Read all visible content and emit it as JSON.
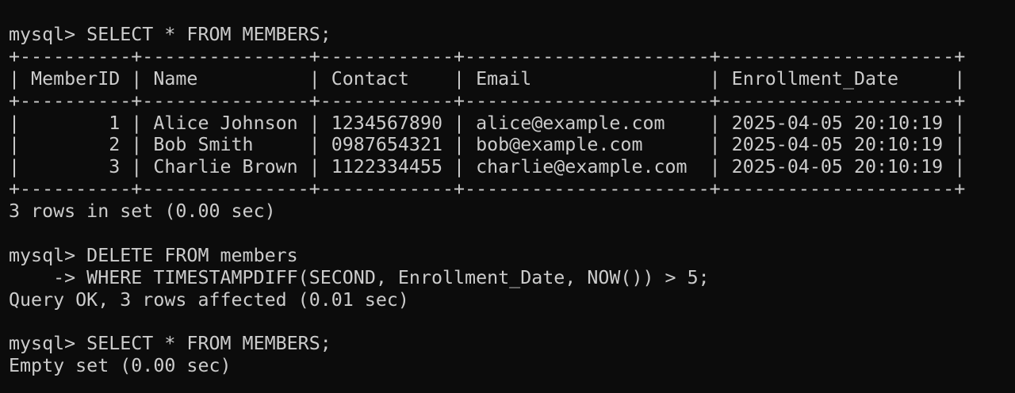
{
  "terminal": {
    "lines": [
      "mysql> SELECT * FROM MEMBERS;",
      "+----------+---------------+------------+----------------------+---------------------+",
      "| MemberID | Name          | Contact    | Email                | Enrollment_Date     |",
      "+----------+---------------+------------+----------------------+---------------------+",
      "|        1 | Alice Johnson | 1234567890 | alice@example.com    | 2025-04-05 20:10:19 |",
      "|        2 | Bob Smith     | 0987654321 | bob@example.com      | 2025-04-05 20:10:19 |",
      "|        3 | Charlie Brown | 1122334455 | charlie@example.com  | 2025-04-05 20:10:19 |",
      "+----------+---------------+------------+----------------------+---------------------+",
      "3 rows in set (0.00 sec)",
      "",
      "mysql> DELETE FROM members",
      "    -> WHERE TIMESTAMPDIFF(SECOND, Enrollment_Date, NOW()) > 5;",
      "Query OK, 3 rows affected (0.01 sec)",
      "",
      "mysql> SELECT * FROM MEMBERS;",
      "Empty set (0.00 sec)"
    ]
  }
}
